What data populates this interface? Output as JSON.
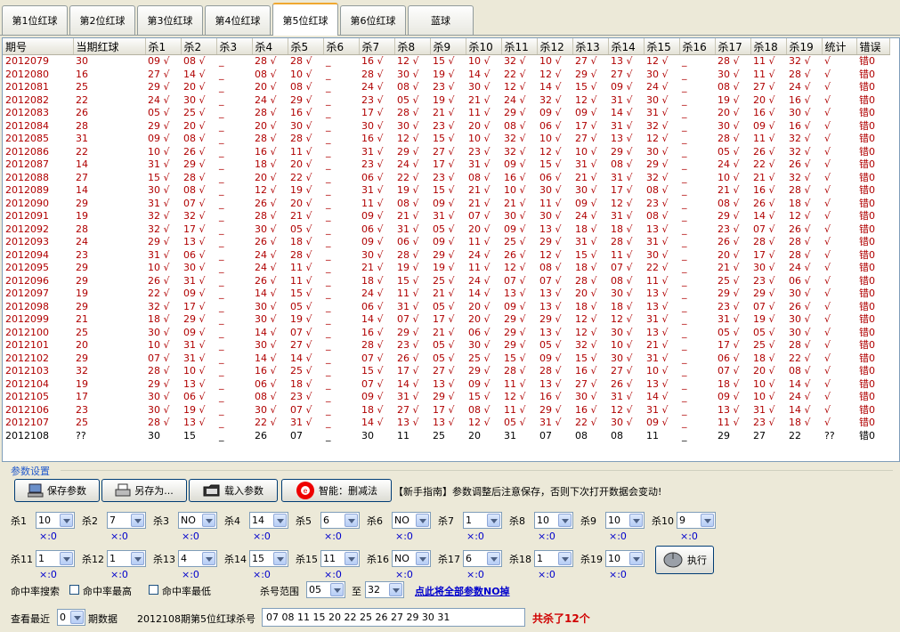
{
  "tabs": [
    "第1位红球",
    "第2位红球",
    "第3位红球",
    "第4位红球",
    "第5位红球",
    "第6位红球",
    "蓝球"
  ],
  "active_tab": 4,
  "columns": [
    "期号",
    "当期红球",
    "杀1",
    "杀2",
    "杀3",
    "杀4",
    "杀5",
    "杀6",
    "杀7",
    "杀8",
    "杀9",
    "杀10",
    "杀11",
    "杀12",
    "杀13",
    "杀14",
    "杀15",
    "杀16",
    "杀17",
    "杀18",
    "杀19",
    "统计",
    "错误"
  ],
  "rows": [
    [
      "2012079",
      "30",
      "09 √",
      "08 √",
      "_",
      "28 √",
      "28 √",
      "_",
      "16 √",
      "12 √",
      "15 √",
      "10 √",
      "32 √",
      "10 √",
      "27 √",
      "13 √",
      "12 √",
      "_",
      "28 √",
      "11 √",
      "32 √",
      "√",
      "错0"
    ],
    [
      "2012080",
      "16",
      "27 √",
      "14 √",
      "_",
      "08 √",
      "10 √",
      "_",
      "28 √",
      "30 √",
      "19 √",
      "14 √",
      "22 √",
      "12 √",
      "29 √",
      "27 √",
      "30 √",
      "_",
      "30 √",
      "11 √",
      "28 √",
      "√",
      "错0"
    ],
    [
      "2012081",
      "25",
      "29 √",
      "20 √",
      "_",
      "20 √",
      "08 √",
      "_",
      "24 √",
      "08 √",
      "23 √",
      "30 √",
      "12 √",
      "14 √",
      "15 √",
      "09 √",
      "24 √",
      "_",
      "08 √",
      "27 √",
      "24 √",
      "√",
      "错0"
    ],
    [
      "2012082",
      "22",
      "24 √",
      "30 √",
      "_",
      "24 √",
      "29 √",
      "_",
      "23 √",
      "05 √",
      "19 √",
      "21 √",
      "24 √",
      "32 √",
      "12 √",
      "31 √",
      "30 √",
      "_",
      "19 √",
      "20 √",
      "16 √",
      "√",
      "错0"
    ],
    [
      "2012083",
      "26",
      "05 √",
      "25 √",
      "_",
      "28 √",
      "16 √",
      "_",
      "17 √",
      "28 √",
      "21 √",
      "11 √",
      "29 √",
      "09 √",
      "09 √",
      "14 √",
      "31 √",
      "_",
      "20 √",
      "16 √",
      "30 √",
      "√",
      "错0"
    ],
    [
      "2012084",
      "28",
      "29 √",
      "20 √",
      "_",
      "20 √",
      "30 √",
      "_",
      "30 √",
      "30 √",
      "23 √",
      "20 √",
      "08 √",
      "06 √",
      "17 √",
      "31 √",
      "32 √",
      "_",
      "30 √",
      "09 √",
      "16 √",
      "√",
      "错0"
    ],
    [
      "2012085",
      "31",
      "09 √",
      "08 √",
      "_",
      "28 √",
      "28 √",
      "_",
      "16 √",
      "12 √",
      "15 √",
      "10 √",
      "32 √",
      "10 √",
      "27 √",
      "13 √",
      "12 √",
      "_",
      "28 √",
      "11 √",
      "32 √",
      "√",
      "错0"
    ],
    [
      "2012086",
      "22",
      "10 √",
      "26 √",
      "_",
      "16 √",
      "11 √",
      "_",
      "31 √",
      "29 √",
      "27 √",
      "23 √",
      "32 √",
      "12 √",
      "10 √",
      "29 √",
      "30 √",
      "_",
      "05 √",
      "26 √",
      "32 √",
      "√",
      "错0"
    ],
    [
      "2012087",
      "14",
      "31 √",
      "29 √",
      "_",
      "18 √",
      "20 √",
      "_",
      "23 √",
      "24 √",
      "17 √",
      "31 √",
      "09 √",
      "15 √",
      "31 √",
      "08 √",
      "29 √",
      "_",
      "24 √",
      "22 √",
      "26 √",
      "√",
      "错0"
    ],
    [
      "2012088",
      "27",
      "15 √",
      "28 √",
      "_",
      "20 √",
      "22 √",
      "_",
      "06 √",
      "22 √",
      "23 √",
      "08 √",
      "16 √",
      "06 √",
      "21 √",
      "31 √",
      "32 √",
      "_",
      "10 √",
      "21 √",
      "32 √",
      "√",
      "错0"
    ],
    [
      "2012089",
      "14",
      "30 √",
      "08 √",
      "_",
      "12 √",
      "19 √",
      "_",
      "31 √",
      "19 √",
      "15 √",
      "21 √",
      "10 √",
      "30 √",
      "30 √",
      "17 √",
      "08 √",
      "_",
      "21 √",
      "16 √",
      "28 √",
      "√",
      "错0"
    ],
    [
      "2012090",
      "29",
      "31 √",
      "07 √",
      "_",
      "26 √",
      "20 √",
      "_",
      "11 √",
      "08 √",
      "09 √",
      "21 √",
      "21 √",
      "11 √",
      "09 √",
      "12 √",
      "23 √",
      "_",
      "08 √",
      "26 √",
      "18 √",
      "√",
      "错0"
    ],
    [
      "2012091",
      "19",
      "32 √",
      "32 √",
      "_",
      "28 √",
      "21 √",
      "_",
      "09 √",
      "21 √",
      "31 √",
      "07 √",
      "30 √",
      "30 √",
      "24 √",
      "31 √",
      "08 √",
      "_",
      "29 √",
      "14 √",
      "12 √",
      "√",
      "错0"
    ],
    [
      "2012092",
      "28",
      "32 √",
      "17 √",
      "_",
      "30 √",
      "05 √",
      "_",
      "06 √",
      "31 √",
      "05 √",
      "20 √",
      "09 √",
      "13 √",
      "18 √",
      "18 √",
      "13 √",
      "_",
      "23 √",
      "07 √",
      "26 √",
      "√",
      "错0"
    ],
    [
      "2012093",
      "24",
      "29 √",
      "13 √",
      "_",
      "26 √",
      "18 √",
      "_",
      "09 √",
      "06 √",
      "09 √",
      "11 √",
      "25 √",
      "29 √",
      "31 √",
      "28 √",
      "31 √",
      "_",
      "26 √",
      "28 √",
      "28 √",
      "√",
      "错0"
    ],
    [
      "2012094",
      "23",
      "31 √",
      "06 √",
      "_",
      "24 √",
      "28 √",
      "_",
      "30 √",
      "28 √",
      "29 √",
      "24 √",
      "26 √",
      "12 √",
      "15 √",
      "11 √",
      "30 √",
      "_",
      "20 √",
      "17 √",
      "28 √",
      "√",
      "错0"
    ],
    [
      "2012095",
      "29",
      "10 √",
      "30 √",
      "_",
      "24 √",
      "11 √",
      "_",
      "21 √",
      "19 √",
      "19 √",
      "11 √",
      "12 √",
      "08 √",
      "18 √",
      "07 √",
      "22 √",
      "_",
      "21 √",
      "30 √",
      "24 √",
      "√",
      "错0"
    ],
    [
      "2012096",
      "29",
      "26 √",
      "31 √",
      "_",
      "26 √",
      "11 √",
      "_",
      "18 √",
      "15 √",
      "25 √",
      "24 √",
      "07 √",
      "07 √",
      "28 √",
      "08 √",
      "11 √",
      "_",
      "25 √",
      "23 √",
      "06 √",
      "√",
      "错0"
    ],
    [
      "2012097",
      "19",
      "22 √",
      "09 √",
      "_",
      "14 √",
      "15 √",
      "_",
      "24 √",
      "11 √",
      "21 √",
      "14 √",
      "13 √",
      "13 √",
      "20 √",
      "30 √",
      "13 √",
      "_",
      "29 √",
      "29 √",
      "30 √",
      "√",
      "错0"
    ],
    [
      "2012098",
      "29",
      "32 √",
      "17 √",
      "_",
      "30 √",
      "05 √",
      "_",
      "06 √",
      "31 √",
      "05 √",
      "20 √",
      "09 √",
      "13 √",
      "18 √",
      "18 √",
      "13 √",
      "_",
      "23 √",
      "07 √",
      "26 √",
      "√",
      "错0"
    ],
    [
      "2012099",
      "21",
      "18 √",
      "29 √",
      "_",
      "30 √",
      "19 √",
      "_",
      "14 √",
      "07 √",
      "17 √",
      "20 √",
      "29 √",
      "29 √",
      "12 √",
      "12 √",
      "31 √",
      "_",
      "31 √",
      "19 √",
      "30 √",
      "√",
      "错0"
    ],
    [
      "2012100",
      "25",
      "30 √",
      "09 √",
      "_",
      "14 √",
      "07 √",
      "_",
      "16 √",
      "29 √",
      "21 √",
      "06 √",
      "29 √",
      "13 √",
      "12 √",
      "30 √",
      "13 √",
      "_",
      "05 √",
      "05 √",
      "30 √",
      "√",
      "错0"
    ],
    [
      "2012101",
      "20",
      "10 √",
      "31 √",
      "_",
      "30 √",
      "27 √",
      "_",
      "28 √",
      "23 √",
      "05 √",
      "30 √",
      "29 √",
      "05 √",
      "32 √",
      "10 √",
      "21 √",
      "_",
      "17 √",
      "25 √",
      "28 √",
      "√",
      "错0"
    ],
    [
      "2012102",
      "29",
      "07 √",
      "31 √",
      "_",
      "14 √",
      "14 √",
      "_",
      "07 √",
      "26 √",
      "05 √",
      "25 √",
      "15 √",
      "09 √",
      "15 √",
      "30 √",
      "31 √",
      "_",
      "06 √",
      "18 √",
      "22 √",
      "√",
      "错0"
    ],
    [
      "2012103",
      "32",
      "28 √",
      "10 √",
      "_",
      "16 √",
      "25 √",
      "_",
      "15 √",
      "17 √",
      "27 √",
      "29 √",
      "28 √",
      "28 √",
      "16 √",
      "27 √",
      "10 √",
      "_",
      "07 √",
      "20 √",
      "08 √",
      "√",
      "错0"
    ],
    [
      "2012104",
      "19",
      "29 √",
      "13 √",
      "_",
      "06 √",
      "18 √",
      "_",
      "07 √",
      "14 √",
      "13 √",
      "09 √",
      "11 √",
      "13 √",
      "27 √",
      "26 √",
      "13 √",
      "_",
      "18 √",
      "10 √",
      "14 √",
      "√",
      "错0"
    ],
    [
      "2012105",
      "17",
      "30 √",
      "06 √",
      "_",
      "08 √",
      "23 √",
      "_",
      "09 √",
      "31 √",
      "29 √",
      "15 √",
      "12 √",
      "16 √",
      "30 √",
      "31 √",
      "14 √",
      "_",
      "09 √",
      "10 √",
      "24 √",
      "√",
      "错0"
    ],
    [
      "2012106",
      "23",
      "30 √",
      "19 √",
      "_",
      "30 √",
      "07 √",
      "_",
      "18 √",
      "27 √",
      "17 √",
      "08 √",
      "11 √",
      "29 √",
      "16 √",
      "12 √",
      "31 √",
      "_",
      "13 √",
      "31 √",
      "14 √",
      "√",
      "错0"
    ],
    [
      "2012107",
      "25",
      "28 √",
      "13 √",
      "_",
      "22 √",
      "31 √",
      "_",
      "14 √",
      "13 √",
      "13 √",
      "12 √",
      "05 √",
      "31 √",
      "22 √",
      "30 √",
      "09 √",
      "_",
      "11 √",
      "23 √",
      "18 √",
      "√",
      "错0"
    ],
    [
      "2012108",
      "??",
      "30",
      "15",
      "_",
      "26",
      "07",
      "_",
      "30",
      "11",
      "25",
      "20",
      "31",
      "07",
      "08",
      "08",
      "11",
      "_",
      "29",
      "27",
      "22",
      "??",
      "错0"
    ]
  ],
  "settings": {
    "section_label": "参数设置",
    "buttons": {
      "save": "保存参数",
      "save_as": "另存为...",
      "load": "载入参数",
      "smart": "智能：删减法",
      "execute": "执行"
    },
    "hint": "【新手指南】参数调整后注意保存，否则下次打开数据会变动!",
    "kills": [
      {
        "label": "杀1",
        "value": "10",
        "stat": "×:0"
      },
      {
        "label": "杀2",
        "value": "7",
        "stat": "×:0"
      },
      {
        "label": "杀3",
        "value": "NO",
        "stat": "×:0"
      },
      {
        "label": "杀4",
        "value": "14",
        "stat": "×:0"
      },
      {
        "label": "杀5",
        "value": "6",
        "stat": "×:0"
      },
      {
        "label": "杀6",
        "value": "NO",
        "stat": "×:0"
      },
      {
        "label": "杀7",
        "value": "1",
        "stat": "×:0"
      },
      {
        "label": "杀8",
        "value": "10",
        "stat": "×:0"
      },
      {
        "label": "杀9",
        "value": "10",
        "stat": "×:0"
      },
      {
        "label": "杀10",
        "value": "9",
        "stat": "×:0"
      },
      {
        "label": "杀11",
        "value": "1",
        "stat": "×:0"
      },
      {
        "label": "杀12",
        "value": "1",
        "stat": "×:0"
      },
      {
        "label": "杀13",
        "value": "4",
        "stat": "×:0"
      },
      {
        "label": "杀14",
        "value": "15",
        "stat": "×:0"
      },
      {
        "label": "杀15",
        "value": "11",
        "stat": "×:0"
      },
      {
        "label": "杀16",
        "value": "NO",
        "stat": "×:0"
      },
      {
        "label": "杀17",
        "value": "6",
        "stat": "×:0"
      },
      {
        "label": "杀18",
        "value": "1",
        "stat": "×:0"
      },
      {
        "label": "杀19",
        "value": "10",
        "stat": "×:0"
      }
    ],
    "hit_search_label": "命中率搜索",
    "hit_max_label": "命中率最高",
    "hit_min_label": "命中率最低",
    "range_label": "杀号范围",
    "range_from": "05",
    "range_to_label": "至",
    "range_to": "32",
    "reset_link": "点此将全部参数NO掉",
    "recent_label": "查看最近",
    "recent_value": "0",
    "recent_suffix": "期数据",
    "result_label": "2012108期第5位红球杀号",
    "result_value": "07 08 11 15 20 22 25 26 27 29 30 31",
    "total_killed": "共杀了12个"
  }
}
